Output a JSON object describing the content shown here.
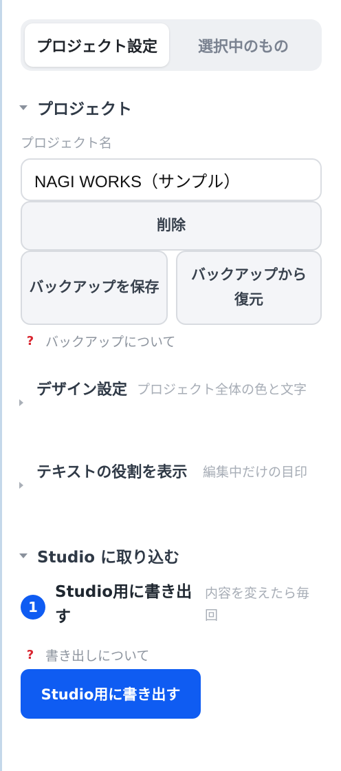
{
  "tabs": [
    {
      "label": "プロジェクト設定",
      "active": true
    },
    {
      "label": "選択中のもの",
      "active": false
    }
  ],
  "project_section": {
    "title": "プロジェクト",
    "name_label": "プロジェクト名",
    "name_value": "NAGI WORKS（サンプル）",
    "delete_label": "削除",
    "backup_save_label": "バックアップを保存",
    "backup_restore_label": "バックアップから復元",
    "help_mark": "?",
    "backup_help": "バックアップについて"
  },
  "design_section": {
    "title": "デザイン設定",
    "description": "プロジェクト全体の色と文字"
  },
  "text_role_section": {
    "title": "テキストの役割を表示",
    "description": "編集中だけの目印"
  },
  "studio_section": {
    "title": "Studio に取り込む",
    "step_number": "1",
    "step_title": "Studio用に書き出す",
    "step_description": "内容を変えたら毎回",
    "help_mark": "?",
    "export_help": "書き出しについて",
    "export_button": "Studio用に書き出す"
  },
  "colors": {
    "accent": "#0f5cf2",
    "help_mark": "#d9252f",
    "button_bg": "#f4f5f8"
  },
  "icons": [
    "caret-down-icon",
    "caret-right-icon",
    "question-icon",
    "step-number-badge"
  ]
}
